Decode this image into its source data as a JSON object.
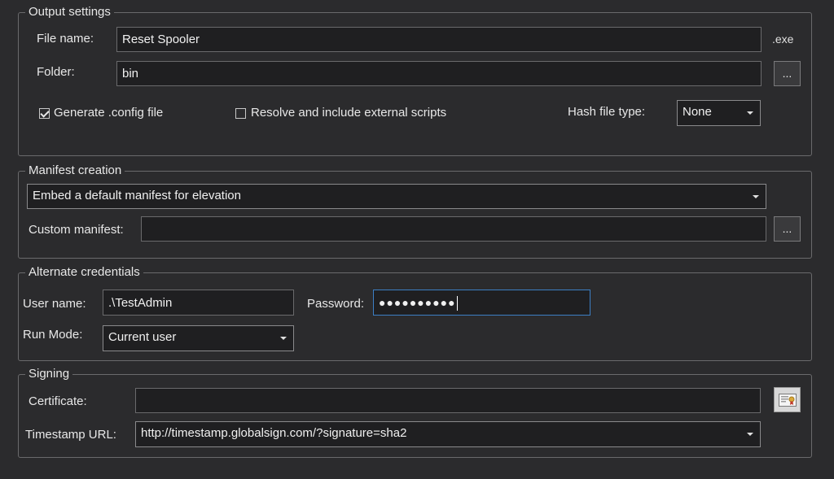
{
  "output": {
    "legend": "Output settings",
    "file_name_label": "File name:",
    "file_name_value": "Reset Spooler",
    "ext": ".exe",
    "folder_label": "Folder:",
    "folder_value": "bin",
    "browse_label": "...",
    "generate_config_label": "Generate .config file",
    "generate_config_checked": true,
    "resolve_scripts_label": "Resolve and include external scripts",
    "resolve_scripts_checked": false,
    "hash_label": "Hash file type:",
    "hash_value": "None"
  },
  "manifest": {
    "legend": "Manifest creation",
    "mode_value": "Embed a default manifest for elevation",
    "custom_label": "Custom manifest:",
    "custom_value": "",
    "browse_label": "..."
  },
  "credentials": {
    "legend": "Alternate credentials",
    "user_label": "User name:",
    "user_value": ".\\TestAdmin",
    "password_label": "Password:",
    "password_value": "●●●●●●●●●●",
    "run_mode_label": "Run Mode:",
    "run_mode_value": "Current user"
  },
  "signing": {
    "legend": "Signing",
    "cert_label": "Certificate:",
    "cert_value": "",
    "timestamp_label": "Timestamp URL:",
    "timestamp_value": "http://timestamp.globalsign.com/?signature=sha2"
  },
  "icons": {
    "certificate_picker": "certificate-icon"
  }
}
